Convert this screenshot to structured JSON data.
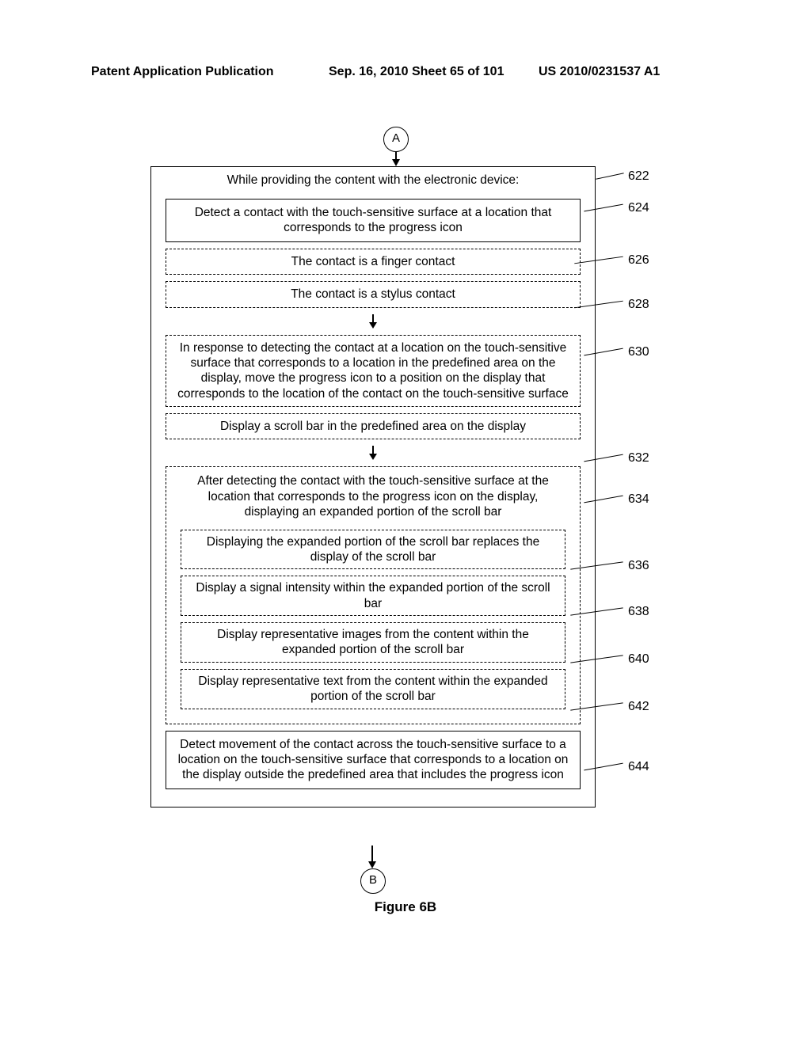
{
  "header": {
    "left": "Patent Application Publication",
    "mid": "Sep. 16, 2010  Sheet 65 of 101",
    "right": "US 2010/0231537 A1"
  },
  "connectors": {
    "top": "A",
    "bottom": "B"
  },
  "refs": {
    "r622": "622",
    "r624": "624",
    "r626": "626",
    "r628": "628",
    "r630": "630",
    "r632": "632",
    "r634": "634",
    "r636": "636",
    "r638": "638",
    "r640": "640",
    "r642": "642",
    "r644": "644"
  },
  "boxes": {
    "b622_title": "While providing the content with the electronic device:",
    "b624": "Detect a contact with the touch-sensitive surface at a location that corresponds to the progress icon",
    "b626": "The contact is a finger contact",
    "b628": "The contact is a stylus contact",
    "b630": "In response to detecting the contact at a location on the touch-sensitive surface that corresponds to a location in the predefined area on the display, move the progress icon to a position on the display that corresponds to the location of the contact on the touch-sensitive surface",
    "b632": "Display a scroll bar in the predefined area on the display",
    "b634": "After detecting the contact with the touch-sensitive surface at the location that corresponds to the progress icon on the display, displaying an expanded portion of the scroll bar",
    "b636": "Displaying the expanded portion of the scroll bar replaces the display of the scroll bar",
    "b638": "Display a signal intensity within the expanded portion of the scroll bar",
    "b640": "Display representative images from the content within the expanded portion of the scroll bar",
    "b642": "Display representative text from the content within the expanded portion of the scroll bar",
    "b644": "Detect movement of the contact across the touch-sensitive surface to a location on the touch-sensitive surface that corresponds to a location on the display outside the predefined area that includes the progress icon"
  },
  "figure_caption": "Figure 6B"
}
